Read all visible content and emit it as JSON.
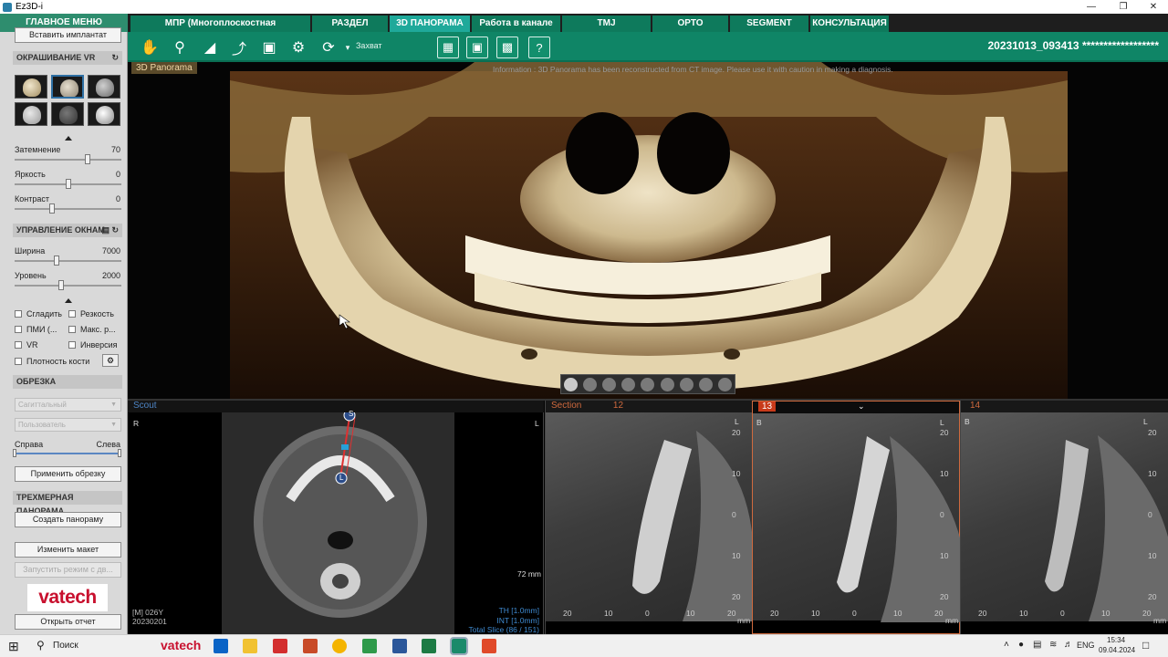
{
  "window": {
    "title": "Ez3D-i"
  },
  "menu": {
    "main_label": "ГЛАВНОЕ МЕНЮ"
  },
  "tabs": [
    {
      "label": "МПР (Многоплоскостная реконструкция)",
      "active": false
    },
    {
      "label": "РАЗДЕЛ",
      "active": false
    },
    {
      "label": "3D ПАНОРАМА",
      "active": true
    },
    {
      "label": "Работа в канале зуба",
      "active": false
    },
    {
      "label": "TMJ",
      "active": false
    },
    {
      "label": "ОРТО",
      "active": false
    },
    {
      "label": "SEGMENT",
      "active": false
    },
    {
      "label": "КОНСУЛЬТАЦИЯ",
      "active": false
    }
  ],
  "toolbar": {
    "capture_label": "Захват",
    "study_id": "20231013_093413 ******************",
    "help_label": "?"
  },
  "sidebar": {
    "insert_implant": "Вставить имплантат",
    "vr_section": "ОКРАШИВАНИЕ VR",
    "sliders_vr": [
      {
        "label": "Затемнение",
        "value": "70",
        "level": 0.69
      },
      {
        "label": "Яркость",
        "value": "0",
        "level": 0.5
      },
      {
        "label": "Контраст",
        "value": "0",
        "level": 0.34
      }
    ],
    "window_section": "УПРАВЛЕНИЕ ОКНАМ",
    "sliders_window": [
      {
        "label": "Ширина",
        "value": "7000",
        "level": 0.39
      },
      {
        "label": "Уровень",
        "value": "2000",
        "level": 0.43
      }
    ],
    "checkboxes": [
      "Сгладить",
      "Резкость",
      "ПМИ (...",
      "Макс. р...",
      "VR",
      "Инверсия",
      "Плотность кости"
    ],
    "crop_section": "ОБРЕЗКА",
    "crop_plane": "Сагиттальный",
    "crop_user": "Пользователь",
    "crop_right": "Справа",
    "crop_left": "Слева",
    "apply_crop": "Применить обрезку",
    "pano_section": "ТРЕХМЕРНАЯ ПАНОРАМА",
    "create_pano": "Создать панораму",
    "change_layout": "Изменить макет",
    "run_mode": "Запустить режим с дв...",
    "logo": "vatech",
    "open_report": "Открыть отчет"
  },
  "mainview": {
    "label": "3D Panorama",
    "info": "Information : 3D Panorama has been reconstructed from CT image. Please use it with caution in making a diagnosis."
  },
  "scout": {
    "label": "Scout",
    "orient_r": "R",
    "orient_l": "L",
    "patient": "[M] 026Y",
    "date": "20230201",
    "scale": "72 mm",
    "marker_top": "S",
    "marker_bottom": "L",
    "th": "TH [1.0mm]",
    "int": "INT [1.0mm]",
    "total": "Total Slice (86 / 151)"
  },
  "sections": [
    {
      "header": "Section",
      "num": "12",
      "b": "",
      "l": "L",
      "active": false
    },
    {
      "header": "",
      "num": "13",
      "b": "B",
      "l": "L",
      "active": true
    },
    {
      "header": "",
      "num": "14",
      "b": "B",
      "l": "L",
      "active": false
    }
  ],
  "section_scale": {
    "y": [
      "20",
      "10",
      "0",
      "10",
      "20"
    ],
    "x": [
      "20",
      "10",
      "0",
      "10",
      "20"
    ],
    "unit": "mm"
  },
  "taskbar": {
    "search": "Поиск",
    "brand": "vatech",
    "lang": "ENG",
    "time": "15:34",
    "date": "09.04.2024"
  }
}
